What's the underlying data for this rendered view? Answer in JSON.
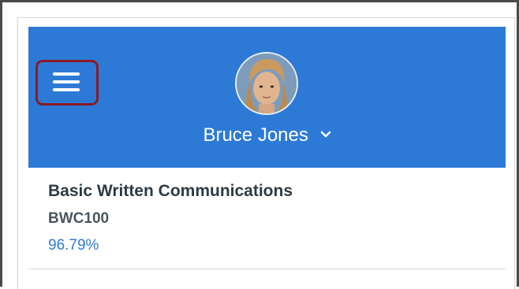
{
  "header": {
    "background_color": "#2d7ad6",
    "menu_icon": "hamburger-menu-icon",
    "menu_highlight_color": "#8b1a24",
    "user_name": "Bruce Jones",
    "user_menu_icon": "chevron-down-icon"
  },
  "course": {
    "title": "Basic Written Communications",
    "code": "BWC100",
    "grade": "96.79%",
    "grade_color": "#2d7ad6"
  }
}
